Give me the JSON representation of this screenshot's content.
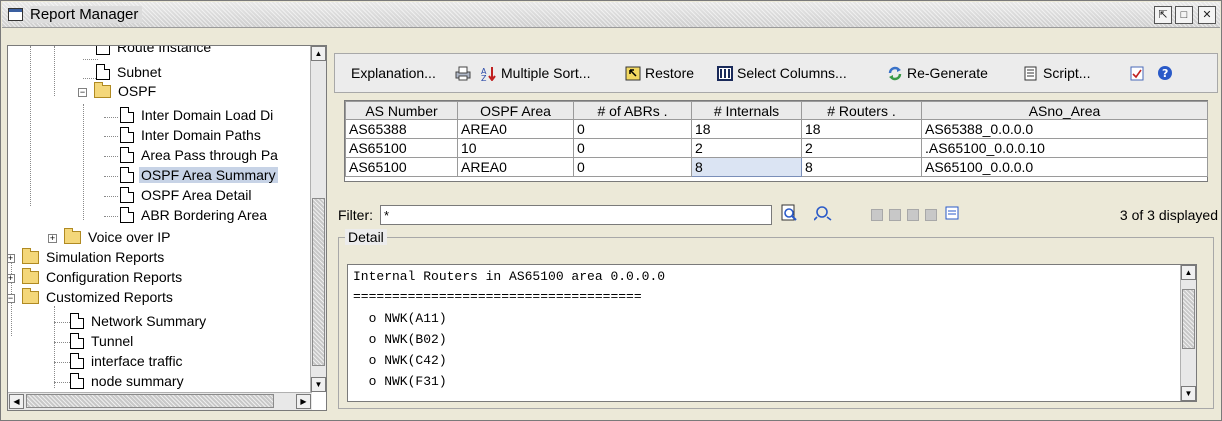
{
  "window": {
    "title": "Report Manager"
  },
  "tree": {
    "items": [
      {
        "label": "Route Instance",
        "type": "doc"
      },
      {
        "label": "Subnet",
        "type": "doc"
      },
      {
        "label": "OSPF",
        "type": "folder",
        "expander": "−"
      },
      {
        "label": "Inter Domain Load Di",
        "type": "doc"
      },
      {
        "label": "Inter Domain Paths",
        "type": "doc"
      },
      {
        "label": "Area Pass through Pa",
        "type": "doc"
      },
      {
        "label": "OSPF Area Summary",
        "type": "doc",
        "selected": true
      },
      {
        "label": "OSPF Area Detail",
        "type": "doc"
      },
      {
        "label": "ABR Bordering Area",
        "type": "doc"
      },
      {
        "label": "Voice over IP",
        "type": "folder",
        "expander": "+"
      },
      {
        "label": "Simulation Reports",
        "type": "folder",
        "expander": "+"
      },
      {
        "label": "Configuration Reports",
        "type": "folder",
        "expander": "+"
      },
      {
        "label": "Customized Reports",
        "type": "folder",
        "expander": "−"
      },
      {
        "label": "Network Summary",
        "type": "doc"
      },
      {
        "label": "Tunnel",
        "type": "doc"
      },
      {
        "label": "interface traffic",
        "type": "doc"
      },
      {
        "label": "node summary",
        "type": "doc"
      }
    ]
  },
  "toolbar": {
    "explanation": "Explanation...",
    "multiple_sort": "Multiple Sort...",
    "restore": "Restore",
    "select_columns": "Select Columns...",
    "regenerate": "Re-Generate",
    "script": "Script..."
  },
  "table": {
    "headers": [
      "AS Number",
      "OSPF Area",
      "# of ABRs .",
      "# Internals",
      "# Routers .",
      "ASno_Area"
    ],
    "rows": [
      [
        "AS65388",
        "AREA0",
        "0",
        "18",
        "18",
        "AS65388_0.0.0.0"
      ],
      [
        "AS65100",
        "10",
        "0",
        "2",
        "2",
        ".AS65100_0.0.0.10"
      ],
      [
        "AS65100",
        "AREA0",
        "0",
        "8",
        "8",
        "AS65100_0.0.0.0"
      ]
    ]
  },
  "filter": {
    "label": "Filter:",
    "value": "*",
    "status": "3 of 3 displayed"
  },
  "detail": {
    "legend": "Detail",
    "lines": [
      "Internal Routers in AS65100 area 0.0.0.0",
      "=====================================",
      "  o NWK(A11)",
      "  o NWK(B02)",
      "  o NWK(C42)",
      "  o NWK(F31)"
    ]
  }
}
